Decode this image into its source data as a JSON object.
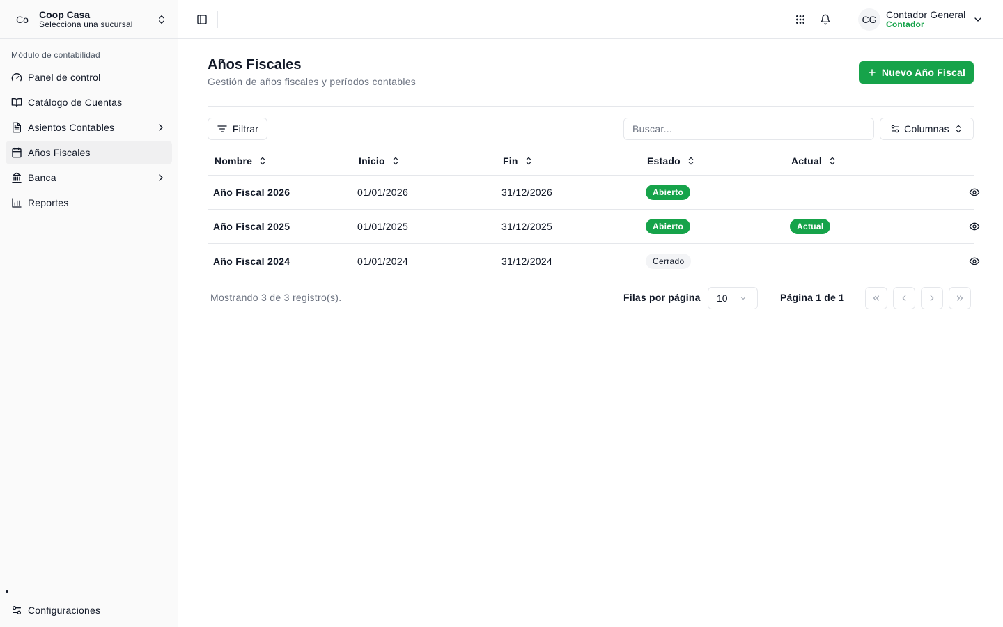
{
  "org": {
    "avatar": "Co",
    "name": "Coop Casa",
    "subtitle": "Selecciona una sucursal"
  },
  "sidebar": {
    "section_label": "Módulo de contabilidad",
    "items": [
      {
        "label": "Panel de control",
        "icon": "gauge-icon"
      },
      {
        "label": "Catálogo de Cuentas",
        "icon": "book-open-icon"
      },
      {
        "label": "Asientos Contables",
        "icon": "file-text-icon",
        "has_submenu": true
      },
      {
        "label": "Años Fiscales",
        "icon": "calendar-icon",
        "active": true
      },
      {
        "label": "Banca",
        "icon": "bank-icon",
        "has_submenu": true
      },
      {
        "label": "Reportes",
        "icon": "bar-chart-icon"
      }
    ],
    "settings_label": "Configuraciones"
  },
  "user": {
    "avatar": "CG",
    "name": "Contador General",
    "role": "Contador"
  },
  "page": {
    "title": "Años Fiscales",
    "subtitle": "Gestión de años fiscales y períodos contables",
    "new_button": "Nuevo Año Fiscal"
  },
  "toolbar": {
    "filter_label": "Filtrar",
    "search_placeholder": "Buscar...",
    "columns_label": "Columnas"
  },
  "table": {
    "headers": [
      "Nombre",
      "Inicio",
      "Fin",
      "Estado",
      "Actual"
    ],
    "rows": [
      {
        "nombre": "Año Fiscal 2026",
        "inicio": "01/01/2026",
        "fin": "31/12/2026",
        "estado": "Abierto",
        "actual": ""
      },
      {
        "nombre": "Año Fiscal 2025",
        "inicio": "01/01/2025",
        "fin": "31/12/2025",
        "estado": "Abierto",
        "actual": "Actual"
      },
      {
        "nombre": "Año Fiscal 2024",
        "inicio": "01/01/2024",
        "fin": "31/12/2024",
        "estado": "Cerrado",
        "actual": ""
      }
    ]
  },
  "pagination": {
    "summary": "Mostrando 3 de 3 registro(s).",
    "rows_per_page_label": "Filas por página",
    "rows_per_page_value": "10",
    "page_info": "Página 1 de 1"
  },
  "colors": {
    "accent": "#16a34a",
    "border": "#e5e7eb",
    "muted_text": "#6b7280"
  }
}
